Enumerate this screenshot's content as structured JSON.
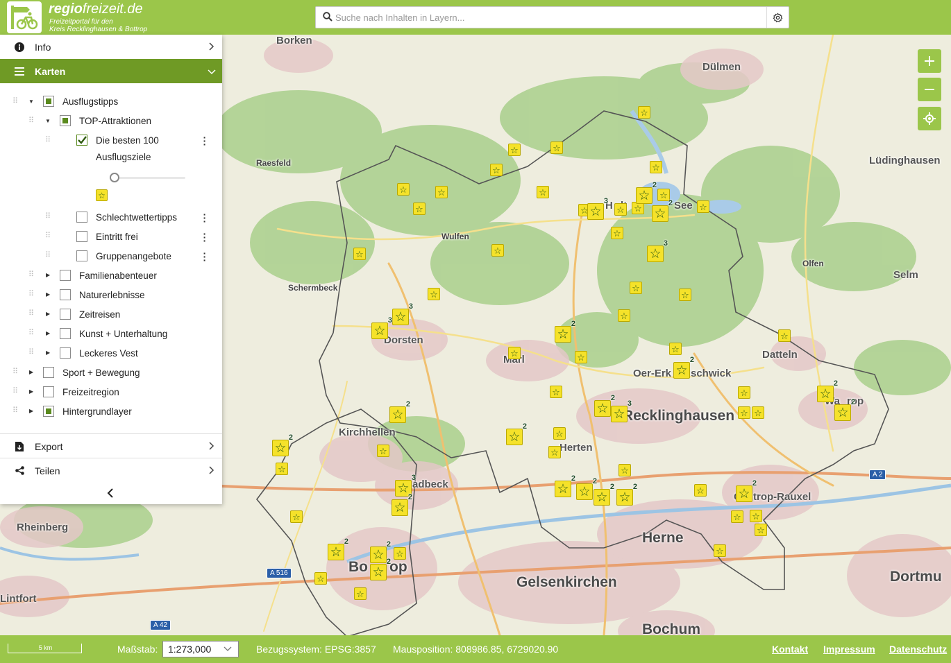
{
  "header": {
    "brand_bold": "regio",
    "brand_rest": "freizeit.de",
    "subtitle_line1": "Freizeitportal für den",
    "subtitle_line2": "Kreis Recklinghausen & Bottrop",
    "search_placeholder": "Suche nach Inhalten in Layern..."
  },
  "panel": {
    "info_label": "Info",
    "karten_label": "Karten",
    "export_label": "Export",
    "teilen_label": "Teilen",
    "tree": {
      "ausflugstipps": "Ausflugstipps",
      "top_attraktionen": "TOP-Attraktionen",
      "die_besten_line1": "Die besten 100",
      "die_besten_line2": "Ausflugsziele",
      "schlechtwetter": "Schlechtwettertipps",
      "eintritt_frei": "Eintritt frei",
      "gruppenangebote": "Gruppenangebote",
      "familienabenteuer": "Familienabenteuer",
      "naturerlebnisse": "Naturerlebnisse",
      "zeitreisen": "Zeitreisen",
      "kunst": "Kunst + Unterhaltung",
      "leckeres_vest": "Leckeres Vest",
      "sport": "Sport + Bewegung",
      "freizeitregion": "Freizeitregion",
      "hintergrundlayer": "Hintergrundlayer"
    },
    "layer_opacity": 0
  },
  "map": {
    "cities": {
      "borken": "Borken",
      "duelmen": "Dülmen",
      "raesfeld": "Raesfeld",
      "luedinghausen": "Lüdinghausen",
      "see": "See",
      "wulfen": "Wulfen",
      "olfen": "Olfen",
      "selm": "Selm",
      "schermbeck": "Schermbeck",
      "dorsten": "Dorsten",
      "marl": "Marl",
      "datteln": "Datteln",
      "oer": "Oer-Erk",
      "schwick": "schwick",
      "waltrop": "Wa",
      "waltrop2": "rop",
      "recklinghausen": "Recklinghausen",
      "kirchhellen": "Kirchhellen",
      "herten": "Herten",
      "gladbeck": "adbeck",
      "castrop": "C",
      "castrop2": "trop-Rauxel",
      "rheinberg": "Rheinberg",
      "herne": "Herne",
      "bottrop1": "Bo",
      "bottrop2": "op",
      "gelsenkirchen": "Gelsenkirchen",
      "dortmund": "Dortmu",
      "lintfort": "Lintfort",
      "bochum": "Bochum",
      "haltern": "H",
      "haltern2": "lt"
    },
    "road_signs": {
      "a2": "A 2",
      "a516": "A 516",
      "a42": "A 42"
    },
    "cluster_counts": [
      "2",
      "3"
    ]
  },
  "footer": {
    "scale_bar_label": "5 km",
    "massstab_label": "Maßstab:",
    "scale_value": "1:273,000",
    "bezugssystem": "Bezugssystem: EPSG:3857",
    "mausposition": "Mausposition: 808986.85, 6729020.90",
    "kontakt": "Kontakt",
    "impressum": "Impressum",
    "datenschutz": "Datenschutz"
  },
  "colors": {
    "header_green": "#9bc64a",
    "active_green": "#6f9a25",
    "marker_yellow": "#f5e22a",
    "star_green": "#2b5a12"
  }
}
